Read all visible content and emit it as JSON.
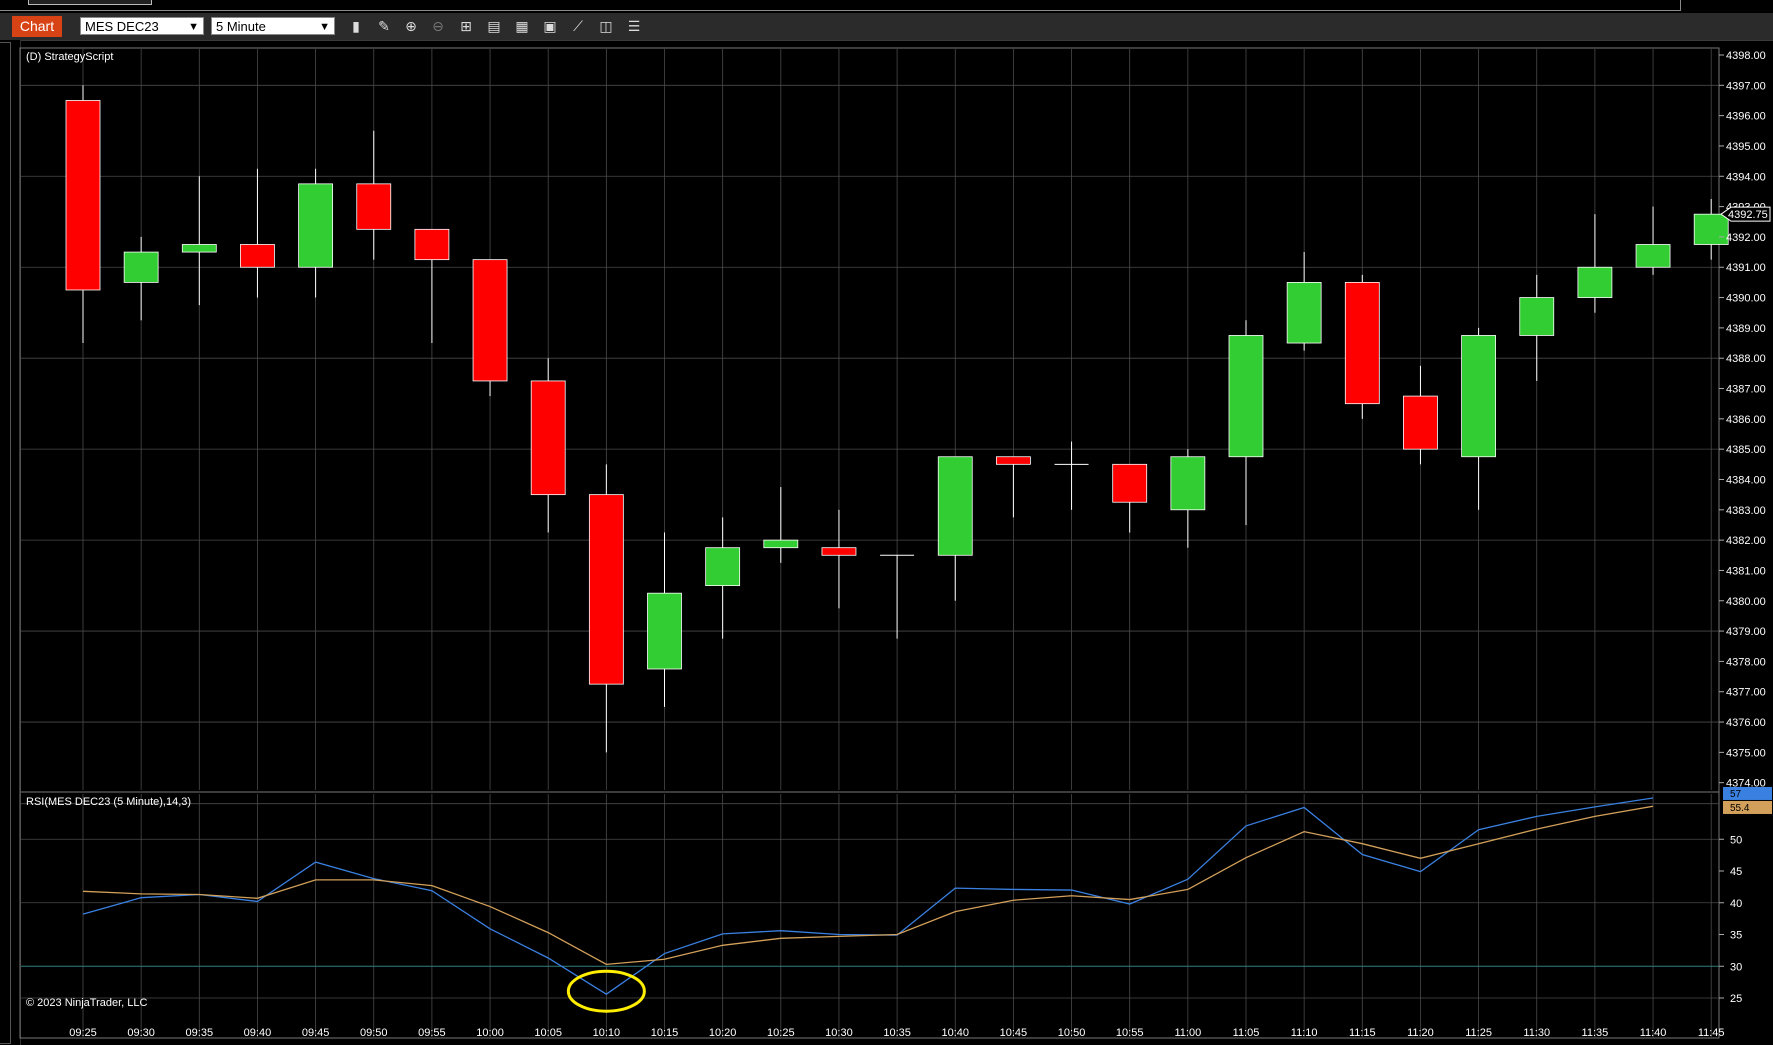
{
  "toolbar": {
    "chart_tab": "Chart",
    "instrument": "MES DEC23",
    "interval": "5 Minute",
    "icons": [
      "bar-type-icon",
      "draw-pencil-icon",
      "zoom-in-icon",
      "zoom-out-icon",
      "crosshair-icon",
      "data-box-icon",
      "properties-icon",
      "templates-icon",
      "strategies-icon",
      "indicators-icon",
      "grid-toggle-icon"
    ]
  },
  "colors": {
    "up": "#32cd32",
    "down": "#ff0000",
    "rsi": "#3a80e0",
    "avg": "#d2a05a",
    "grid": "#4a4a4a",
    "highlight": "#ffee00",
    "chart_tab": "#d84315"
  },
  "chart_data": [
    {
      "type": "candlestick",
      "title": "(D) StrategyScript",
      "ylim": [
        4373.5,
        4398.3
      ],
      "yticks": [
        "4374.00",
        "4375.00",
        "4376.00",
        "4377.00",
        "4378.00",
        "4379.00",
        "4380.00",
        "4381.00",
        "4382.00",
        "4383.00",
        "4384.00",
        "4385.00",
        "4386.00",
        "4387.00",
        "4388.00",
        "4389.00",
        "4390.00",
        "4391.00",
        "4392.00",
        "4393.00",
        "4394.00",
        "4395.00",
        "4396.00",
        "4397.00",
        "4398.00"
      ],
      "last_price": "4392.75",
      "categories": [
        "09:25",
        "09:30",
        "09:35",
        "09:40",
        "09:45",
        "09:50",
        "09:55",
        "10:00",
        "10:05",
        "10:10",
        "10:15",
        "10:20",
        "10:25",
        "10:30",
        "10:35",
        "10:40",
        "10:45",
        "10:50",
        "10:55",
        "11:00",
        "11:05",
        "11:10",
        "11:15",
        "11:20",
        "11:25",
        "11:30",
        "11:35",
        "11:40",
        "11:45"
      ],
      "candles": [
        {
          "o": 4396.5,
          "h": 4397.0,
          "l": 4388.5,
          "c": 4390.25
        },
        {
          "o": 4390.5,
          "h": 4392.0,
          "l": 4389.25,
          "c": 4391.5
        },
        {
          "o": 4391.5,
          "h": 4394.0,
          "l": 4389.75,
          "c": 4391.75
        },
        {
          "o": 4391.75,
          "h": 4394.25,
          "l": 4390.0,
          "c": 4391.0
        },
        {
          "o": 4391.0,
          "h": 4394.25,
          "l": 4390.0,
          "c": 4393.75
        },
        {
          "o": 4393.75,
          "h": 4395.5,
          "l": 4391.25,
          "c": 4392.25
        },
        {
          "o": 4392.25,
          "h": 4392.25,
          "l": 4388.5,
          "c": 4391.25
        },
        {
          "o": 4391.25,
          "h": 4391.25,
          "l": 4386.75,
          "c": 4387.25
        },
        {
          "o": 4387.25,
          "h": 4388.0,
          "l": 4382.25,
          "c": 4383.5
        },
        {
          "o": 4383.5,
          "h": 4384.5,
          "l": 4375.0,
          "c": 4377.25
        },
        {
          "o": 4377.75,
          "h": 4382.25,
          "l": 4376.5,
          "c": 4380.25
        },
        {
          "o": 4380.5,
          "h": 4382.75,
          "l": 4378.75,
          "c": 4381.75
        },
        {
          "o": 4381.75,
          "h": 4383.75,
          "l": 4381.25,
          "c": 4382.0
        },
        {
          "o": 4381.75,
          "h": 4383.0,
          "l": 4379.75,
          "c": 4381.5
        },
        {
          "o": 4381.5,
          "h": 4381.5,
          "l": 4378.75,
          "c": 4381.5
        },
        {
          "o": 4381.5,
          "h": 4384.75,
          "l": 4380.0,
          "c": 4384.75
        },
        {
          "o": 4384.75,
          "h": 4384.75,
          "l": 4382.75,
          "c": 4384.5
        },
        {
          "o": 4384.5,
          "h": 4385.25,
          "l": 4383.0,
          "c": 4384.5
        },
        {
          "o": 4384.5,
          "h": 4384.5,
          "l": 4382.25,
          "c": 4383.25
        },
        {
          "o": 4383.0,
          "h": 4385.0,
          "l": 4381.75,
          "c": 4384.75
        },
        {
          "o": 4384.75,
          "h": 4389.25,
          "l": 4382.5,
          "c": 4388.75
        },
        {
          "o": 4388.5,
          "h": 4391.5,
          "l": 4388.25,
          "c": 4390.5
        },
        {
          "o": 4390.5,
          "h": 4390.75,
          "l": 4386.0,
          "c": 4386.5
        },
        {
          "o": 4386.75,
          "h": 4387.75,
          "l": 4384.5,
          "c": 4385.0
        },
        {
          "o": 4384.75,
          "h": 4389.0,
          "l": 4383.0,
          "c": 4388.75
        },
        {
          "o": 4388.75,
          "h": 4390.75,
          "l": 4387.25,
          "c": 4390.0
        },
        {
          "o": 4390.0,
          "h": 4392.75,
          "l": 4389.5,
          "c": 4391.0
        },
        {
          "o": 4391.0,
          "h": 4393.0,
          "l": 4390.75,
          "c": 4391.75
        },
        {
          "o": 4391.75,
          "h": 4393.25,
          "l": 4391.25,
          "c": 4392.75
        }
      ]
    },
    {
      "type": "line",
      "title": "RSI(MES DEC23 (5 Minute),14,3)",
      "ylim": [
        23,
        59
      ],
      "yticks": [
        "25",
        "30",
        "35",
        "40",
        "45",
        "50"
      ],
      "reference_line": 30,
      "current_labels": {
        "rsi": "57",
        "avg": "55.4"
      },
      "x": [
        "09:25",
        "09:30",
        "09:35",
        "09:40",
        "09:45",
        "09:50",
        "09:55",
        "10:00",
        "10:05",
        "10:10",
        "10:15",
        "10:20",
        "10:25",
        "10:30",
        "10:35",
        "10:40",
        "10:45",
        "10:50",
        "10:55",
        "11:00",
        "11:05",
        "11:10",
        "11:15",
        "11:20",
        "11:25",
        "11:30",
        "11:35",
        "11:40"
      ],
      "series": [
        {
          "key": "rsi",
          "values": [
            38.2,
            40.8,
            41.3,
            40.2,
            46.4,
            43.8,
            41.9,
            35.9,
            31.3,
            25.6,
            32.0,
            35.1,
            35.6,
            35.0,
            34.9,
            42.3,
            42.1,
            42.0,
            39.8,
            43.7,
            52.1,
            55.0,
            47.6,
            44.9,
            51.5,
            53.6,
            55.1,
            56.5
          ]
        },
        {
          "key": "avg",
          "values": [
            41.8,
            41.4,
            41.3,
            40.7,
            43.6,
            43.6,
            42.7,
            39.4,
            35.3,
            30.3,
            31.1,
            33.3,
            34.4,
            34.7,
            35.0,
            38.6,
            40.4,
            41.1,
            40.5,
            42.1,
            47.1,
            51.2,
            49.3,
            47.0,
            49.3,
            51.6,
            53.6,
            55.2
          ]
        }
      ],
      "x_axis_labels": [
        "09:25",
        "09:30",
        "09:35",
        "09:40",
        "09:45",
        "09:50",
        "09:55",
        "10:00",
        "10:05",
        "10:10",
        "10:15",
        "10:20",
        "10:25",
        "10:30",
        "10:35",
        "10:40",
        "10:45",
        "10:50",
        "10:55",
        "11:00",
        "11:05",
        "11:10",
        "11:15",
        "11:20",
        "11:25",
        "11:30",
        "11:35",
        "11:40",
        "11:45"
      ],
      "highlight_time": "10:10"
    }
  ],
  "copyright": "© 2023 NinjaTrader, LLC"
}
